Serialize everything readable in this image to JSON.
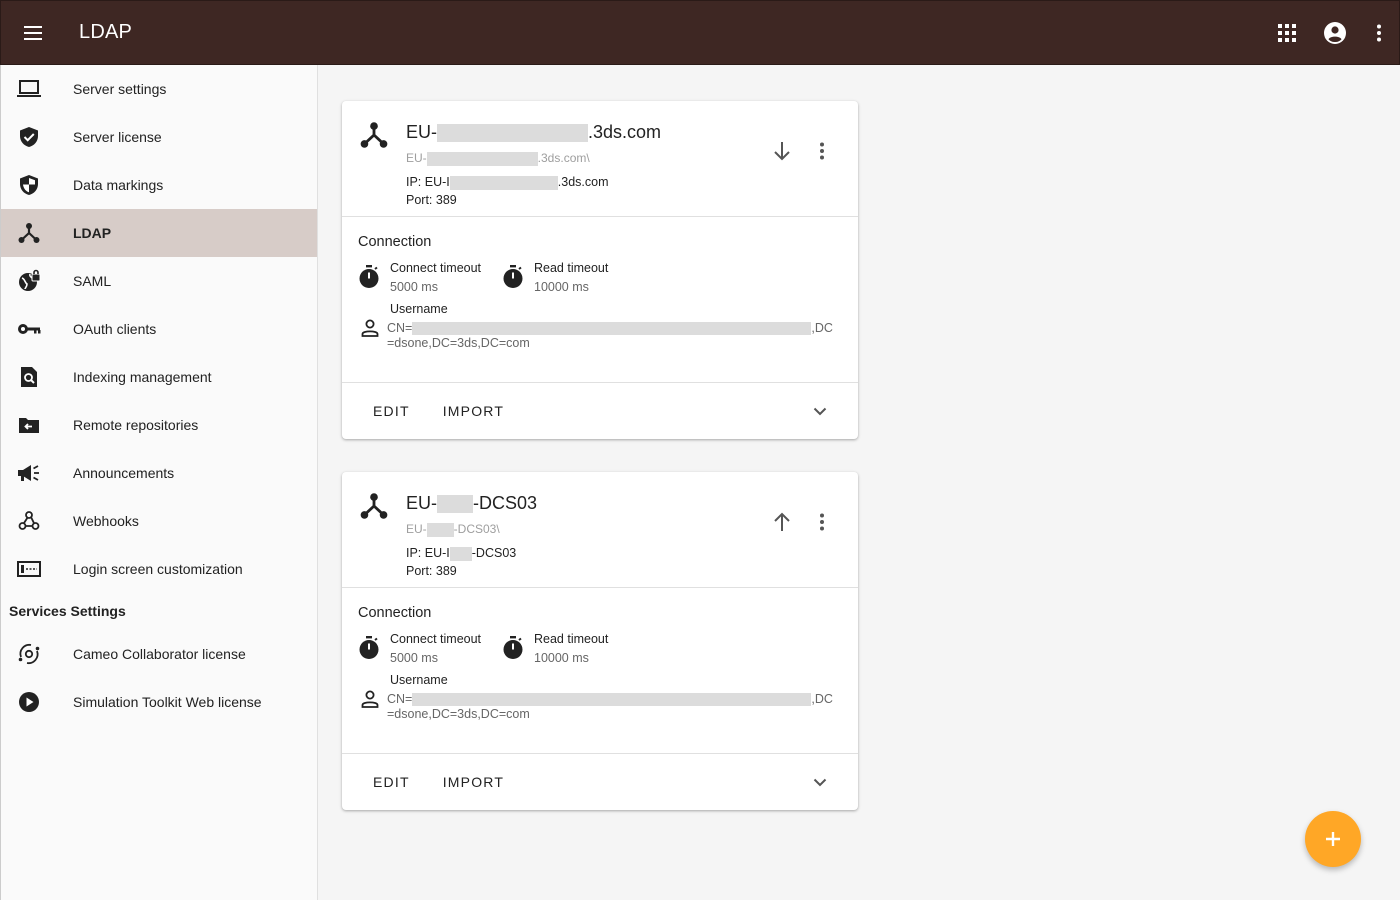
{
  "app": {
    "title": "LDAP",
    "icons": {
      "menu": "menu-icon",
      "apps": "apps-grid-icon",
      "account": "account-circle-icon",
      "more": "more-vert-icon"
    }
  },
  "sidebar": {
    "items": [
      {
        "label": "Server settings",
        "icon": "laptop-icon"
      },
      {
        "label": "Server license",
        "icon": "verified-shield-icon"
      },
      {
        "label": "Data markings",
        "icon": "shield-half-icon"
      },
      {
        "label": "LDAP",
        "icon": "network-hub-icon",
        "active": true
      },
      {
        "label": "SAML",
        "icon": "public-lock-icon"
      },
      {
        "label": "OAuth clients",
        "icon": "key-icon"
      },
      {
        "label": "Indexing management",
        "icon": "find-in-page-icon"
      },
      {
        "label": "Remote repositories",
        "icon": "drive-folder-icon"
      },
      {
        "label": "Announcements",
        "icon": "campaign-icon"
      },
      {
        "label": "Webhooks",
        "icon": "webhook-icon"
      },
      {
        "label": "Login screen customization",
        "icon": "web-asset-icon"
      }
    ],
    "services_header": "Services Settings",
    "services": [
      {
        "label": "Cameo Collaborator license",
        "icon": "orbit-icon"
      },
      {
        "label": "Simulation Toolkit Web license",
        "icon": "play-circle-icon"
      }
    ]
  },
  "servers": [
    {
      "name_prefix": "EU-",
      "name_suffix": ".3ds.com",
      "sub_prefix": "EU-",
      "sub_suffix": ".3ds.com\\",
      "ip_prefix": "IP: EU-I",
      "ip_suffix": ".3ds.com",
      "port": "Port: 389",
      "move": "arrow-down-icon",
      "connection_label": "Connection",
      "connect_timeout_label": "Connect timeout",
      "connect_timeout_value": "5000 ms",
      "read_timeout_label": "Read timeout",
      "read_timeout_value": "10000 ms",
      "username_label": "Username",
      "username_prefix": "CN=",
      "username_suffix": ",DC=dsone,DC=3ds,DC=com",
      "edit": "EDIT",
      "import": "IMPORT"
    },
    {
      "name_prefix": "EU-",
      "name_suffix": "-DCS03",
      "sub_prefix": "EU-",
      "sub_suffix": "-DCS03\\",
      "ip_prefix": "IP: EU-I",
      "ip_suffix": "-DCS03",
      "port": "Port: 389",
      "move": "arrow-up-icon",
      "connection_label": "Connection",
      "connect_timeout_label": "Connect timeout",
      "connect_timeout_value": "5000 ms",
      "read_timeout_label": "Read timeout",
      "read_timeout_value": "10000 ms",
      "username_label": "Username",
      "username_prefix": "CN=",
      "username_suffix": ",DC=dsone,DC=3ds,DC=com",
      "edit": "EDIT",
      "import": "IMPORT"
    }
  ],
  "fab": {
    "icon": "add-icon"
  },
  "colors": {
    "appbar": "#3e2723",
    "active_nav": "#d7ccc8",
    "fab": "#ffa726"
  }
}
